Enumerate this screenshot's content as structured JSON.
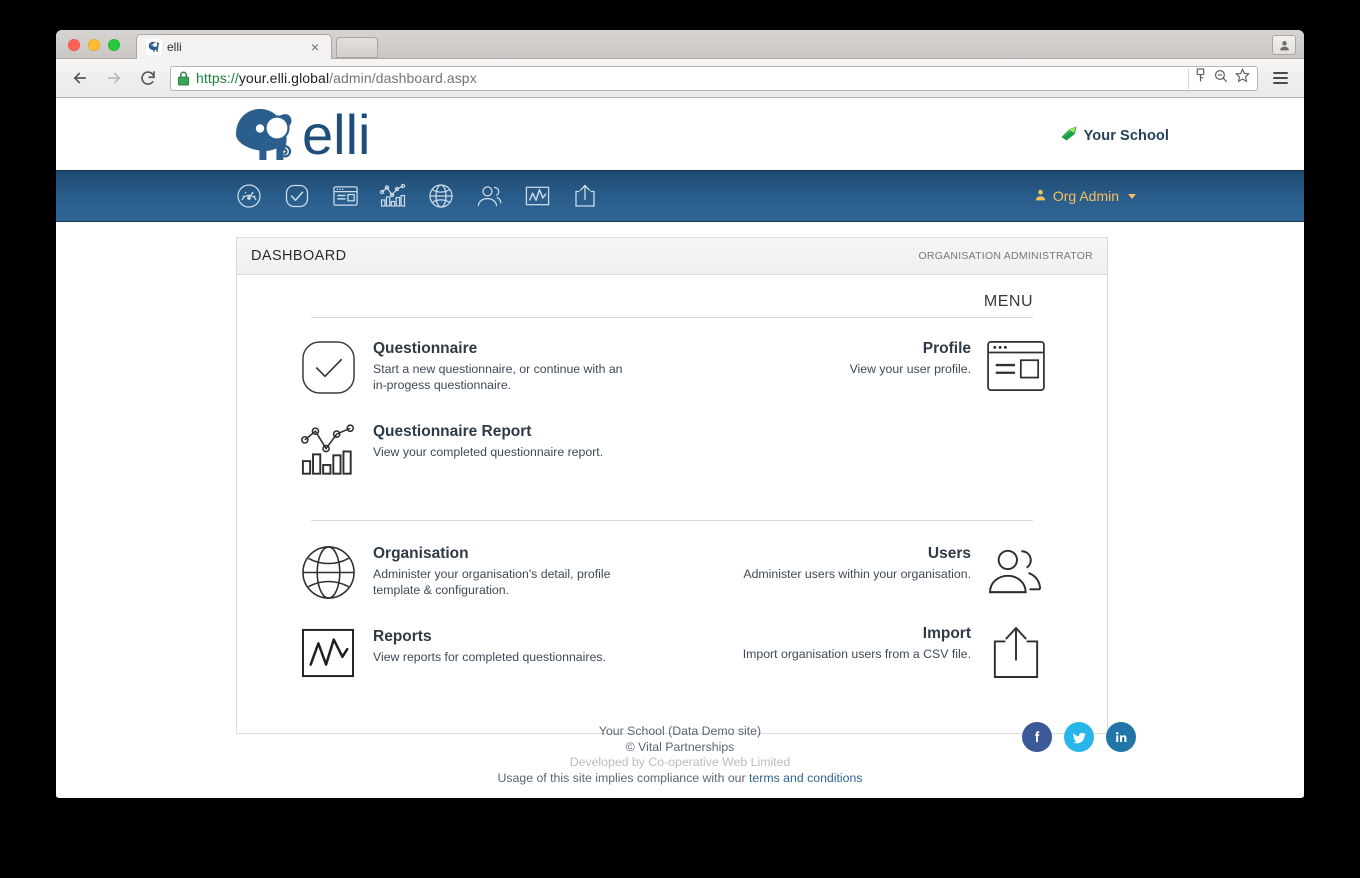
{
  "browser": {
    "tab_title": "elli",
    "tab_favicon_icon": "elli-elephant-favicon",
    "tab_close_label": "×",
    "back_icon": "back-arrow-icon",
    "forward_icon": "forward-arrow-icon",
    "reload_icon": "reload-icon",
    "lock_icon": "padlock-icon",
    "url_scheme": "https://",
    "url_host": "your.elli.global",
    "url_path": "/admin/dashboard.aspx",
    "url_full": "https://your.elli.global/admin/dashboard.aspx",
    "omnibox_actions": [
      "key-icon",
      "zoom-out-icon",
      "bookmark-star-icon"
    ],
    "menu_icon": "hamburger-menu-icon",
    "profile_chip_icon": "user-profile-icon"
  },
  "header": {
    "brand_name": "elli",
    "brand_icon": "elli-elephant-logo",
    "school_name": "Your School",
    "school_icon": "green-leaf-logo"
  },
  "navbar": {
    "icons": [
      {
        "name": "dashboard-gauge-icon",
        "label": "Dashboard"
      },
      {
        "name": "questionnaire-check-icon",
        "label": "Questionnaire"
      },
      {
        "name": "profile-window-icon",
        "label": "Profile"
      },
      {
        "name": "questionnaire-report-chart-icon",
        "label": "Questionnaire Report"
      },
      {
        "name": "organisation-globe-icon",
        "label": "Organisation"
      },
      {
        "name": "users-people-icon",
        "label": "Users"
      },
      {
        "name": "reports-graph-icon",
        "label": "Reports"
      },
      {
        "name": "import-upload-icon",
        "label": "Import"
      }
    ],
    "user_label": "Org Admin",
    "user_icon": "user-avatar-icon",
    "caret_icon": "chevron-down-icon",
    "accent_color": "#f5c05a",
    "bar_color_top": "#1d4a70",
    "bar_color_bottom": "#2f6696"
  },
  "dashboard": {
    "card_title": "DASHBOARD",
    "card_role": "ORGANISATION ADMINISTRATOR",
    "menu_label": "MENU",
    "tiles_group_one": {
      "left": [
        {
          "title": "Questionnaire",
          "desc": "Start a new questionnaire, or continue with an in-progess questionnaire.",
          "icon": "questionnaire-check-icon"
        },
        {
          "title": "Questionnaire Report",
          "desc": "View your completed questionnaire report.",
          "icon": "questionnaire-report-chart-icon"
        }
      ],
      "right": [
        {
          "title": "Profile",
          "desc": "View your user profile.",
          "icon": "profile-window-icon"
        }
      ]
    },
    "tiles_group_two": {
      "left": [
        {
          "title": "Organisation",
          "desc": "Administer your organisation's detail, profile template & configuration.",
          "icon": "organisation-globe-icon"
        },
        {
          "title": "Reports",
          "desc": "View reports for completed questionnaires.",
          "icon": "reports-graph-icon"
        }
      ],
      "right": [
        {
          "title": "Users",
          "desc": "Administer users within your organisation.",
          "icon": "users-people-icon"
        },
        {
          "title": "Import",
          "desc": "Import organisation users from a CSV file.",
          "icon": "import-upload-icon"
        }
      ]
    }
  },
  "footer": {
    "line1": "Your School (Data Demo site)",
    "line2": "© Vital Partnerships",
    "line3": "Developed by Co-operative Web Limited",
    "line4_prefix": "Usage of this site implies compliance with our ",
    "link_text": "terms and conditions",
    "socials": [
      {
        "name": "facebook-icon",
        "glyph": "f",
        "color": "#3b5998"
      },
      {
        "name": "twitter-icon",
        "glyph": "t",
        "color": "#28b5ea"
      },
      {
        "name": "linkedin-icon",
        "glyph": "in",
        "color": "#2175a8"
      }
    ]
  }
}
